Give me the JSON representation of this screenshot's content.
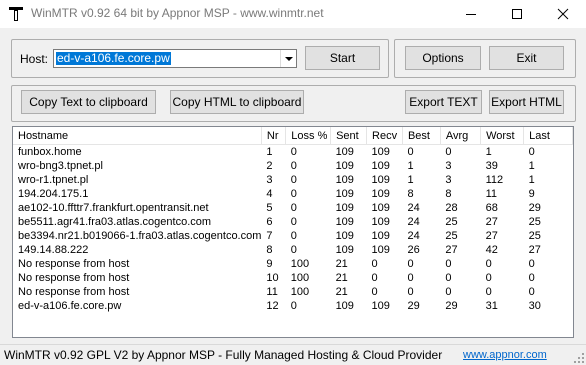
{
  "window": {
    "title": "WinMTR v0.92 64 bit by Appnor MSP - www.winmtr.net"
  },
  "host": {
    "label": "Host:",
    "value": "ed-v-a106.fe.core.pw"
  },
  "buttons": {
    "start": "Start",
    "options": "Options",
    "exit": "Exit",
    "copy_text": "Copy Text to clipboard",
    "copy_html": "Copy HTML to clipboard",
    "export_text": "Export TEXT",
    "export_html": "Export HTML"
  },
  "table": {
    "columns": [
      "Hostname",
      "Nr",
      "Loss %",
      "Sent",
      "Recv",
      "Best",
      "Avrg",
      "Worst",
      "Last"
    ],
    "rows": [
      [
        "funbox.home",
        "1",
        "0",
        "109",
        "109",
        "0",
        "0",
        "1",
        "0"
      ],
      [
        "wro-bng3.tpnet.pl",
        "2",
        "0",
        "109",
        "109",
        "1",
        "3",
        "39",
        "1"
      ],
      [
        "wro-r1.tpnet.pl",
        "3",
        "0",
        "109",
        "109",
        "1",
        "3",
        "112",
        "1"
      ],
      [
        "194.204.175.1",
        "4",
        "0",
        "109",
        "109",
        "8",
        "8",
        "11",
        "9"
      ],
      [
        "ae102-10.ffttr7.frankfurt.opentransit.net",
        "5",
        "0",
        "109",
        "109",
        "24",
        "28",
        "68",
        "29"
      ],
      [
        "be5511.agr41.fra03.atlas.cogentco.com",
        "6",
        "0",
        "109",
        "109",
        "24",
        "25",
        "27",
        "25"
      ],
      [
        "be3394.nr21.b019066-1.fra03.atlas.cogentco.com",
        "7",
        "0",
        "109",
        "109",
        "24",
        "25",
        "27",
        "25"
      ],
      [
        "149.14.88.222",
        "8",
        "0",
        "109",
        "109",
        "26",
        "27",
        "42",
        "27"
      ],
      [
        "No response from host",
        "9",
        "100",
        "21",
        "0",
        "0",
        "0",
        "0",
        "0"
      ],
      [
        "No response from host",
        "10",
        "100",
        "21",
        "0",
        "0",
        "0",
        "0",
        "0"
      ],
      [
        "No response from host",
        "11",
        "100",
        "21",
        "0",
        "0",
        "0",
        "0",
        "0"
      ],
      [
        "ed-v-a106.fe.core.pw",
        "12",
        "0",
        "109",
        "109",
        "29",
        "29",
        "31",
        "30"
      ]
    ]
  },
  "status": {
    "text": "WinMTR v0.92 GPL V2 by Appnor MSP - Fully Managed Hosting & Cloud Provider",
    "link": "www.appnor.com"
  },
  "colors": {
    "selection": "#0078d7",
    "link": "#0066cc",
    "button_face": "#e1e1e1"
  }
}
